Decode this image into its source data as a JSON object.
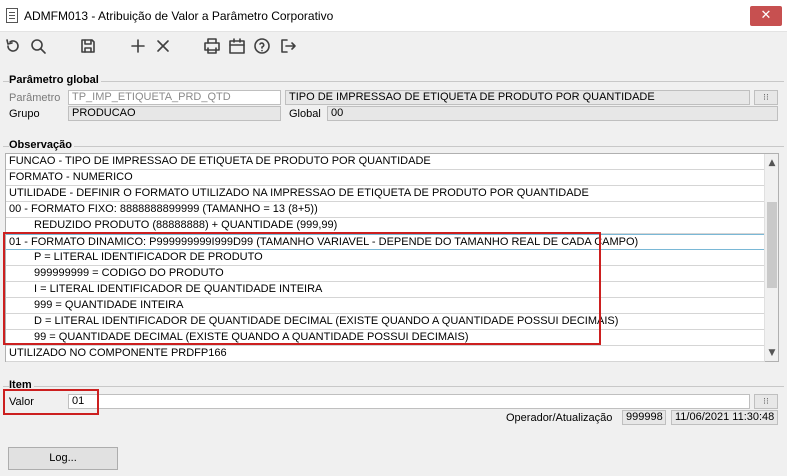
{
  "window": {
    "title": "ADMFM013 - Atribuição de Valor a Parâmetro Corporativo",
    "close_glyph": "✕"
  },
  "toolbar": {
    "icons": [
      "refresh-icon",
      "search-icon",
      "save-icon",
      "add-icon",
      "delete-icon",
      "print-icon",
      "calendar-icon",
      "help-icon",
      "exit-icon"
    ]
  },
  "global": {
    "section_title": "Parâmetro global",
    "parametro_label": "Parâmetro",
    "parametro_value": "TP_IMP_ETIQUETA_PRD_QTD",
    "parametro_desc": "TIPO DE IMPRESSAO DE ETIQUETA DE PRODUTO POR QUANTIDADE",
    "grupo_label": "Grupo",
    "grupo_value": "PRODUCAO",
    "global_label": "Global",
    "global_value": "00"
  },
  "observacao": {
    "section_title": "Observação",
    "lines": [
      "FUNCAO - TIPO DE IMPRESSAO DE ETIQUETA DE PRODUTO POR QUANTIDADE",
      "FORMATO - NUMERICO",
      "UTILIDADE - DEFINIR O FORMATO UTILIZADO NA IMPRESSAO DE ETIQUETA DE PRODUTO POR QUANTIDADE",
      "00 - FORMATO FIXO: 8888888899999 (TAMANHO = 13 (8+5))",
      "REDUZIDO PRODUTO (88888888) + QUANTIDADE (999,99)",
      "01 - FORMATO DINAMICO: P999999999I999D99 (TAMANHO VARIAVEL - DEPENDE DO TAMANHO REAL DE CADA CAMPO)",
      "P = LITERAL IDENTIFICADOR DE PRODUTO",
      "999999999 = CODIGO DO PRODUTO",
      "I = LITERAL IDENTIFICADOR DE QUANTIDADE INTEIRA",
      "999 = QUANTIDADE INTEIRA",
      "D = LITERAL IDENTIFICADOR DE QUANTIDADE DECIMAL (EXISTE QUANDO A QUANTIDADE POSSUI DECIMAIS)",
      "99 = QUANTIDADE DECIMAL (EXISTE QUANDO A QUANTIDADE POSSUI DECIMAIS)",
      "UTILIZADO NO COMPONENTE PRDFP166"
    ]
  },
  "item": {
    "section_title": "Item",
    "valor_label": "Valor",
    "valor_value": "01",
    "operador_label": "Operador/Atualização",
    "operador_value": "999998",
    "data_value": "11/06/2021 11:30:48"
  },
  "lookup_glyph": "⁝⁝",
  "log_button": "Log...",
  "colors": {
    "highlight": "#cc1f1f",
    "close": "#c75050"
  }
}
